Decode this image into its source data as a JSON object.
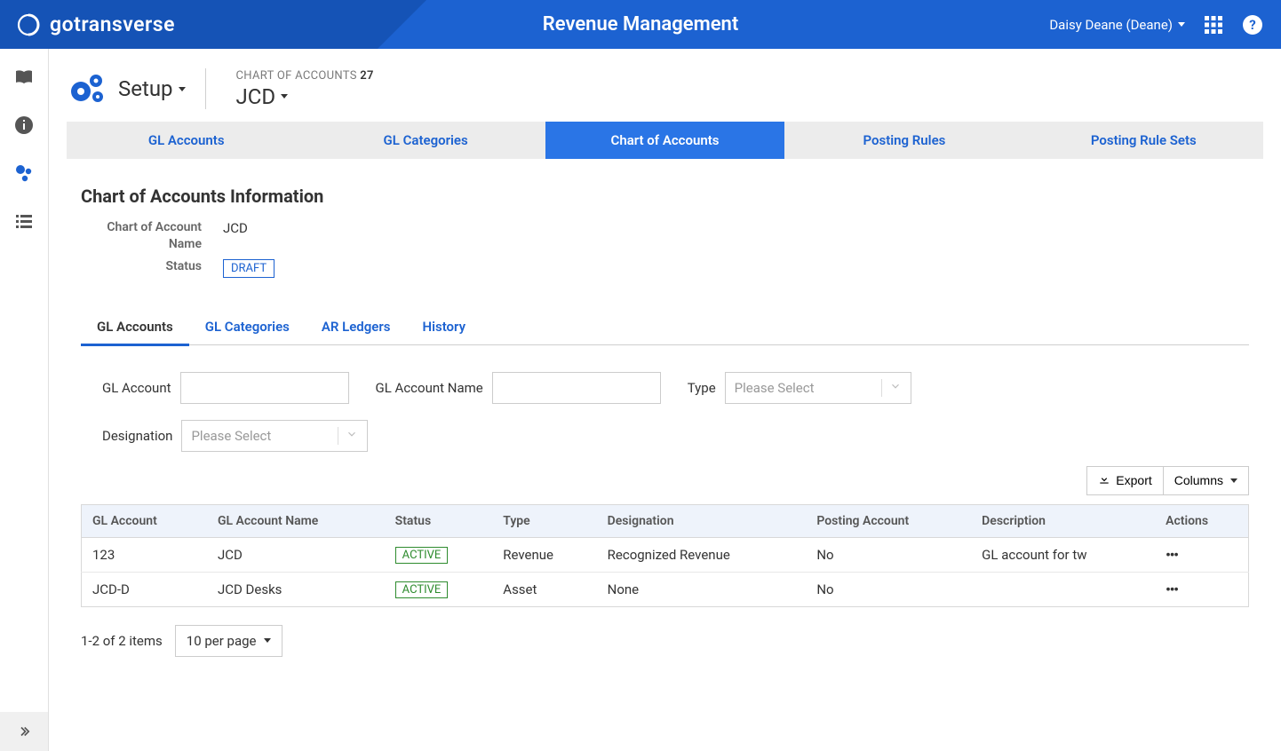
{
  "header": {
    "brand": "gotransverse",
    "title": "Revenue Management",
    "user": "Daisy Deane (Deane)"
  },
  "pagehead": {
    "setup_label": "Setup",
    "bc_label": "CHART OF ACCOUNTS",
    "bc_count": "27",
    "bc_name": "JCD"
  },
  "primary_tabs": [
    {
      "label": "GL Accounts",
      "active": false
    },
    {
      "label": "GL Categories",
      "active": false
    },
    {
      "label": "Chart of Accounts",
      "active": true
    },
    {
      "label": "Posting Rules",
      "active": false
    },
    {
      "label": "Posting Rule Sets",
      "active": false
    }
  ],
  "section": {
    "title": "Chart of Accounts Information",
    "name_label": "Chart of Account Name",
    "name_value": "JCD",
    "status_label": "Status",
    "status_value": "DRAFT"
  },
  "sub_tabs": [
    {
      "label": "GL Accounts",
      "active": true
    },
    {
      "label": "GL Categories",
      "active": false
    },
    {
      "label": "AR Ledgers",
      "active": false
    },
    {
      "label": "History",
      "active": false
    }
  ],
  "filters": {
    "gl_account_label": "GL Account",
    "gl_account_name_label": "GL Account Name",
    "type_label": "Type",
    "designation_label": "Designation",
    "select_placeholder": "Please Select"
  },
  "toolbar": {
    "export_label": "Export",
    "columns_label": "Columns"
  },
  "table": {
    "headers": {
      "gl_account": "GL Account",
      "gl_account_name": "GL Account Name",
      "status": "Status",
      "type": "Type",
      "designation": "Designation",
      "posting_account": "Posting Account",
      "description": "Description",
      "actions": "Actions"
    },
    "rows": [
      {
        "gl_account": "123",
        "gl_account_name": "JCD",
        "status": "ACTIVE",
        "type": "Revenue",
        "designation": "Recognized Revenue",
        "posting_account": "No",
        "description": "GL account for tw"
      },
      {
        "gl_account": "JCD-D",
        "gl_account_name": "JCD Desks",
        "status": "ACTIVE",
        "type": "Asset",
        "designation": "None",
        "posting_account": "No",
        "description": ""
      }
    ]
  },
  "pager": {
    "info": "1-2 of 2 items",
    "per_page": "10 per page"
  }
}
